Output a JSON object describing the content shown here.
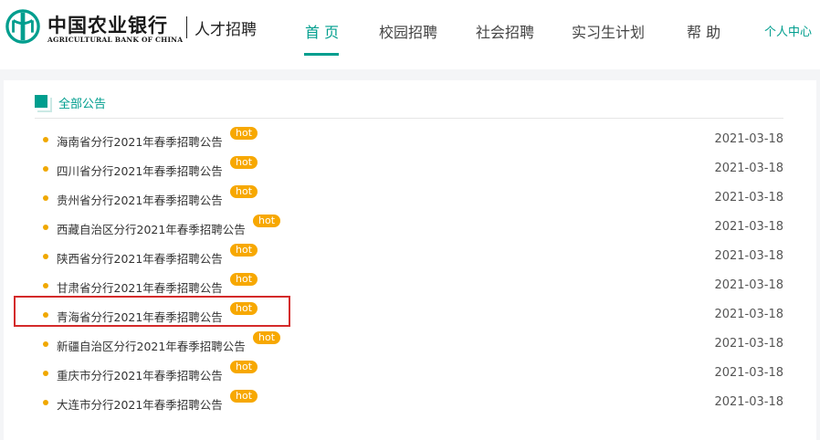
{
  "header": {
    "logo_cn": "中国农业银行",
    "logo_en": "AGRICULTURAL BANK OF CHINA",
    "logo_sub": "人才招聘",
    "nav": [
      {
        "label": "首 页",
        "active": true
      },
      {
        "label": "校园招聘",
        "active": false
      },
      {
        "label": "社会招聘",
        "active": false
      },
      {
        "label": "实习生计划",
        "active": false
      },
      {
        "label": "帮 助",
        "active": false
      }
    ],
    "user_center": "个人中心"
  },
  "section": {
    "title": "全部公告"
  },
  "announcements": [
    {
      "title": "海南省分行2021年春季招聘公告",
      "badge": "hot",
      "date": "2021-03-18"
    },
    {
      "title": "四川省分行2021年春季招聘公告",
      "badge": "hot",
      "date": "2021-03-18"
    },
    {
      "title": "贵州省分行2021年春季招聘公告",
      "badge": "hot",
      "date": "2021-03-18"
    },
    {
      "title": "西藏自治区分行2021年春季招聘公告",
      "badge": "hot",
      "date": "2021-03-18"
    },
    {
      "title": "陕西省分行2021年春季招聘公告",
      "badge": "hot",
      "date": "2021-03-18"
    },
    {
      "title": "甘肃省分行2021年春季招聘公告",
      "badge": "hot",
      "date": "2021-03-18"
    },
    {
      "title": "青海省分行2021年春季招聘公告",
      "badge": "hot",
      "date": "2021-03-18",
      "highlighted": true
    },
    {
      "title": "新疆自治区分行2021年春季招聘公告",
      "badge": "hot",
      "date": "2021-03-18"
    },
    {
      "title": "重庆市分行2021年春季招聘公告",
      "badge": "hot",
      "date": "2021-03-18"
    },
    {
      "title": "大连市分行2021年春季招聘公告",
      "badge": "hot",
      "date": "2021-03-18"
    }
  ],
  "colors": {
    "brand": "#009e8e",
    "hot_badge": "#f7a800",
    "highlight": "#d42a2a"
  }
}
